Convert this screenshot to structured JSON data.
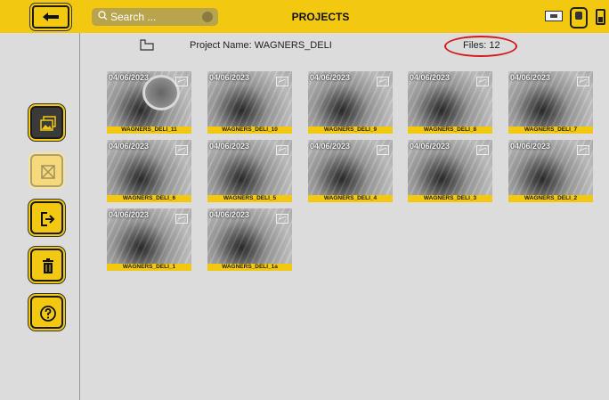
{
  "header": {
    "title": "PROJECTS",
    "search_placeholder": "Search ...",
    "icons": [
      "back-arrow-icon",
      "search-icon",
      "usb-drive-icon",
      "device-icon",
      "battery-icon"
    ]
  },
  "sidebar": {
    "buttons": [
      {
        "name": "gallery",
        "icon": "photo-gallery-icon"
      },
      {
        "name": "select",
        "icon": "select-disabled-icon"
      },
      {
        "name": "export",
        "icon": "export-icon"
      },
      {
        "name": "delete",
        "icon": "trash-icon"
      },
      {
        "name": "help",
        "icon": "help-icon"
      }
    ]
  },
  "project": {
    "name_text": "Project Name: WAGNERS_DELI",
    "files_text": "Files: 12"
  },
  "thumbnails": [
    {
      "date": "04/06/2023",
      "label": "WAGNERS_DELI_11"
    },
    {
      "date": "04/06/2023",
      "label": "WAGNERS_DELI_10"
    },
    {
      "date": "04/06/2023",
      "label": "WAGNERS_DELI_9"
    },
    {
      "date": "04/06/2023",
      "label": "WAGNERS_DELI_8"
    },
    {
      "date": "04/06/2023",
      "label": "WAGNERS_DELI_7"
    },
    {
      "date": "04/06/2023",
      "label": "WAGNERS_DELI_6"
    },
    {
      "date": "04/06/2023",
      "label": "WAGNERS_DELI_5"
    },
    {
      "date": "04/06/2023",
      "label": "WAGNERS_DELI_4"
    },
    {
      "date": "04/06/2023",
      "label": "WAGNERS_DELI_3"
    },
    {
      "date": "04/06/2023",
      "label": "WAGNERS_DELI_2"
    },
    {
      "date": "04/06/2023",
      "label": "WAGNERS_DELI_1"
    },
    {
      "date": "04/06/2023",
      "label": "WAGNERS_DELI_1a"
    }
  ],
  "colors": {
    "accent": "#f2c811",
    "annotation": "#d21a1a",
    "background": "#dcdcdc"
  }
}
